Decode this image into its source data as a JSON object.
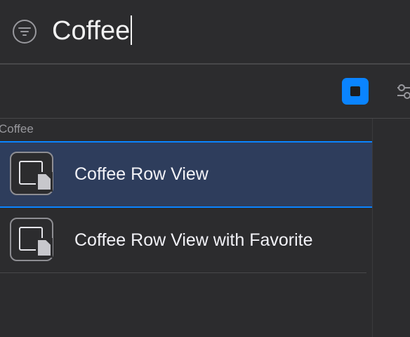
{
  "search": {
    "value": "Coffee",
    "filter_icon": "filter-circle-icon"
  },
  "toolbar": {
    "grid_toggle_icon": "square-grid-icon",
    "adjust_icon": "sliders-icon",
    "accent": "#0a84ff"
  },
  "library": {
    "section_title": "Coffee",
    "items": [
      {
        "label": "Coffee Row View",
        "icon": "view-component-icon",
        "selected": true
      },
      {
        "label": "Coffee Row View with Favorite",
        "icon": "view-component-icon",
        "selected": false
      }
    ]
  },
  "colors": {
    "background": "#2c2c2e",
    "selection": "#2e3d5c",
    "selection_border": "#0a84ff"
  }
}
